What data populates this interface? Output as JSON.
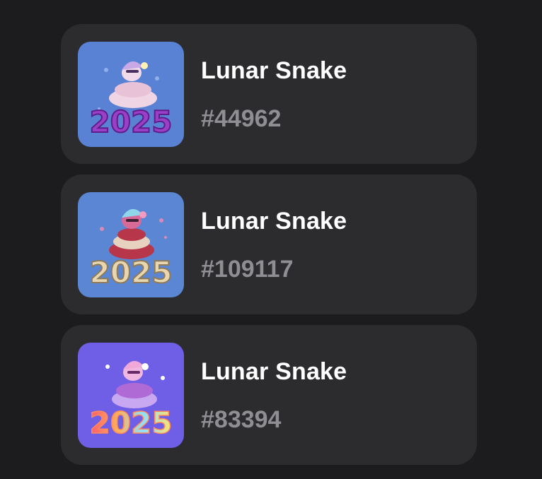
{
  "items": [
    {
      "title": "Lunar Snake",
      "number": "#44962",
      "icon": "lunar-snake-2025-purple",
      "colors": {
        "bg": "#5a82d4",
        "digits": "#9a3fc8",
        "coil": "#f0d6e4",
        "hat": "#c9a8e6"
      }
    },
    {
      "title": "Lunar Snake",
      "number": "#109117",
      "icon": "lunar-snake-2025-beige",
      "colors": {
        "bg": "#5a86d4",
        "digits": "#e8d6b0",
        "coil": "#b7364a",
        "hat": "#8fd6ea"
      }
    },
    {
      "title": "Lunar Snake",
      "number": "#83394",
      "icon": "lunar-snake-2025-rainbow",
      "colors": {
        "bg": "#6f5fe6",
        "digits": "#ff7a7a",
        "coil": "#b06ad6",
        "hat": "#f0a8d8"
      }
    }
  ]
}
